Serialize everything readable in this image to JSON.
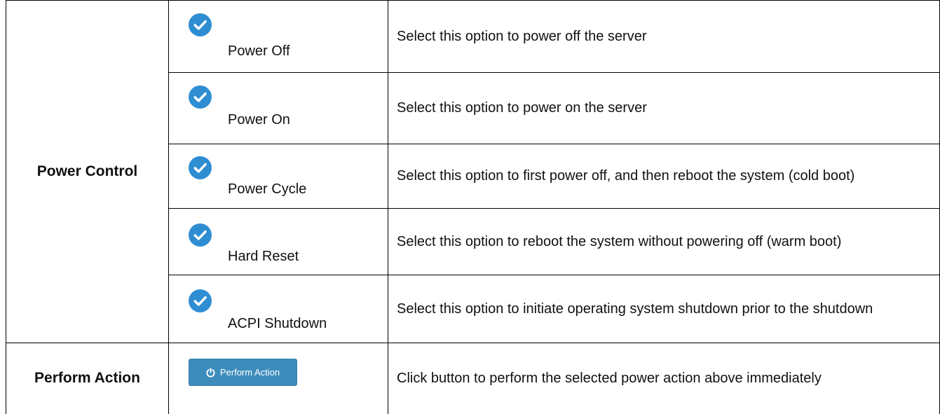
{
  "power_control": {
    "label": "Power Control",
    "options": [
      {
        "label": "Power Off",
        "description": "Select this option to power off the server",
        "icon": "check-circle-icon"
      },
      {
        "label": "Power On",
        "description": "Select this option to power on the server",
        "icon": "check-circle-icon"
      },
      {
        "label": "Power Cycle",
        "description": "Select this option to first power off, and then reboot the system (cold boot)",
        "icon": "check-circle-icon"
      },
      {
        "label": "Hard Reset",
        "description": "Select this option to reboot the system without powering off (warm boot)",
        "icon": "check-circle-icon"
      },
      {
        "label": "ACPI Shutdown",
        "description": "Select this option to initiate operating system shutdown prior to the shutdown",
        "icon": "check-circle-icon"
      }
    ]
  },
  "perform_action": {
    "label": "Perform Action",
    "button_label": "Perform Action",
    "button_icon": "power-icon",
    "description": "Click button to perform the selected power action above immediately"
  },
  "colors": {
    "check_icon": "#2f8dd2",
    "button_bg": "#3c8dbc",
    "border": "#000000"
  }
}
